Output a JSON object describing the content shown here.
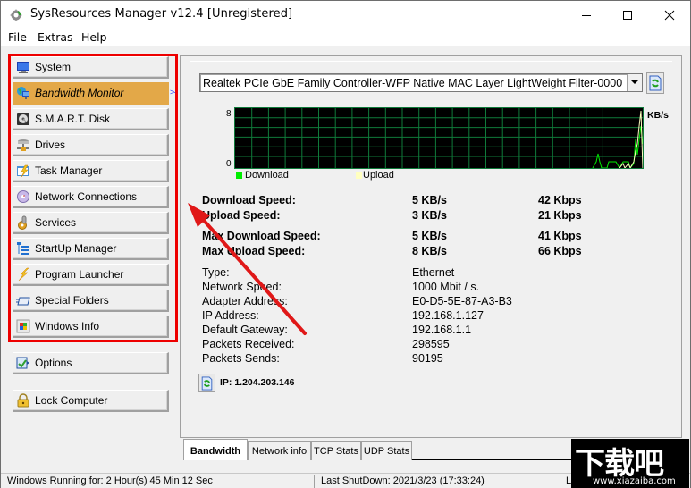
{
  "window": {
    "title": "SysResources Manager  v12.4 [Unregistered]",
    "controls": {
      "minimize": "minimize",
      "maximize": "maximize",
      "close": "close"
    }
  },
  "menu": [
    "File",
    "Extras",
    "Help"
  ],
  "sidebar": {
    "items": [
      {
        "label": "System",
        "icon": "monitor-icon",
        "active": false
      },
      {
        "label": "Bandwidth Monitor",
        "icon": "globe-network-icon",
        "active": true
      },
      {
        "label": "S.M.A.R.T. Disk",
        "icon": "hard-disk-icon",
        "active": false
      },
      {
        "label": "Drives",
        "icon": "network-drives-icon",
        "active": false
      },
      {
        "label": "Task Manager",
        "icon": "task-lightning-icon",
        "active": false
      },
      {
        "label": "Network Connections",
        "icon": "network-disc-icon",
        "active": false
      },
      {
        "label": "Services",
        "icon": "gear-services-icon",
        "active": false
      },
      {
        "label": "StartUp Manager",
        "icon": "tree-list-icon",
        "active": false
      },
      {
        "label": "Program Launcher",
        "icon": "lightning-icon",
        "active": false
      },
      {
        "label": "Special Folders",
        "icon": "folder-icon",
        "active": false
      },
      {
        "label": "Windows Info",
        "icon": "windows-logo-icon",
        "active": false
      }
    ],
    "options_label": "Options",
    "lock_label": "Lock Computer"
  },
  "adapter": {
    "selected": "Realtek PCIe GbE Family Controller-WFP Native MAC Layer LightWeight Filter-0000"
  },
  "graph": {
    "y_max_label": "8",
    "y_min_label": "0",
    "unit": "KB/s",
    "legend": [
      {
        "label": "Download",
        "color": "#00ee00"
      },
      {
        "label": "Upload",
        "color": "#ffffc0"
      }
    ]
  },
  "speeds": {
    "rows": [
      {
        "label": "Download Speed:",
        "kbs": "5 KB/s",
        "kbps": "42 Kbps"
      },
      {
        "label": "Upload Speed:",
        "kbs": "3 KB/s",
        "kbps": "21 Kbps"
      },
      {
        "label": "Max Download Speed:",
        "kbs": "5 KB/s",
        "kbps": "41 Kbps"
      },
      {
        "label": "Max Upload Speed:",
        "kbs": "8 KB/s",
        "kbps": "66 Kbps"
      }
    ]
  },
  "info": {
    "rows": [
      {
        "label": "Type:",
        "value": "Ethernet"
      },
      {
        "label": "Network Speed:",
        "value": "1000 Mbit / s."
      },
      {
        "label": "Adapter Address:",
        "value": "E0-D5-5E-87-A3-B3"
      },
      {
        "label": "IP Address:",
        "value": "192.168.1.127"
      },
      {
        "label": "Default Gateway:",
        "value": "192.168.1.1"
      },
      {
        "label": "Packets Received:",
        "value": "298595"
      },
      {
        "label": "Packets Sends:",
        "value": "90195"
      }
    ],
    "public_ip": "IP: 1.204.203.146"
  },
  "tabs": [
    {
      "label": "Bandwidth",
      "active": true
    },
    {
      "label": "Network info",
      "active": false
    },
    {
      "label": "TCP Stats",
      "active": false
    },
    {
      "label": "UDP Stats",
      "active": false
    }
  ],
  "status": {
    "uptime": "Windows Running for: 2 Hour(s) 45 Min 12 Sec",
    "last_shutdown": "Last ShutDown: 2021/3/23 (17:33:24)",
    "third": "L"
  },
  "watermark": {
    "big": "下载吧",
    "small": "www.xiazaiba.com"
  },
  "colors": {
    "accent_active": "#e3a848",
    "annotation_red": "#ee0000",
    "graph_grid": "#0f7a3a"
  }
}
